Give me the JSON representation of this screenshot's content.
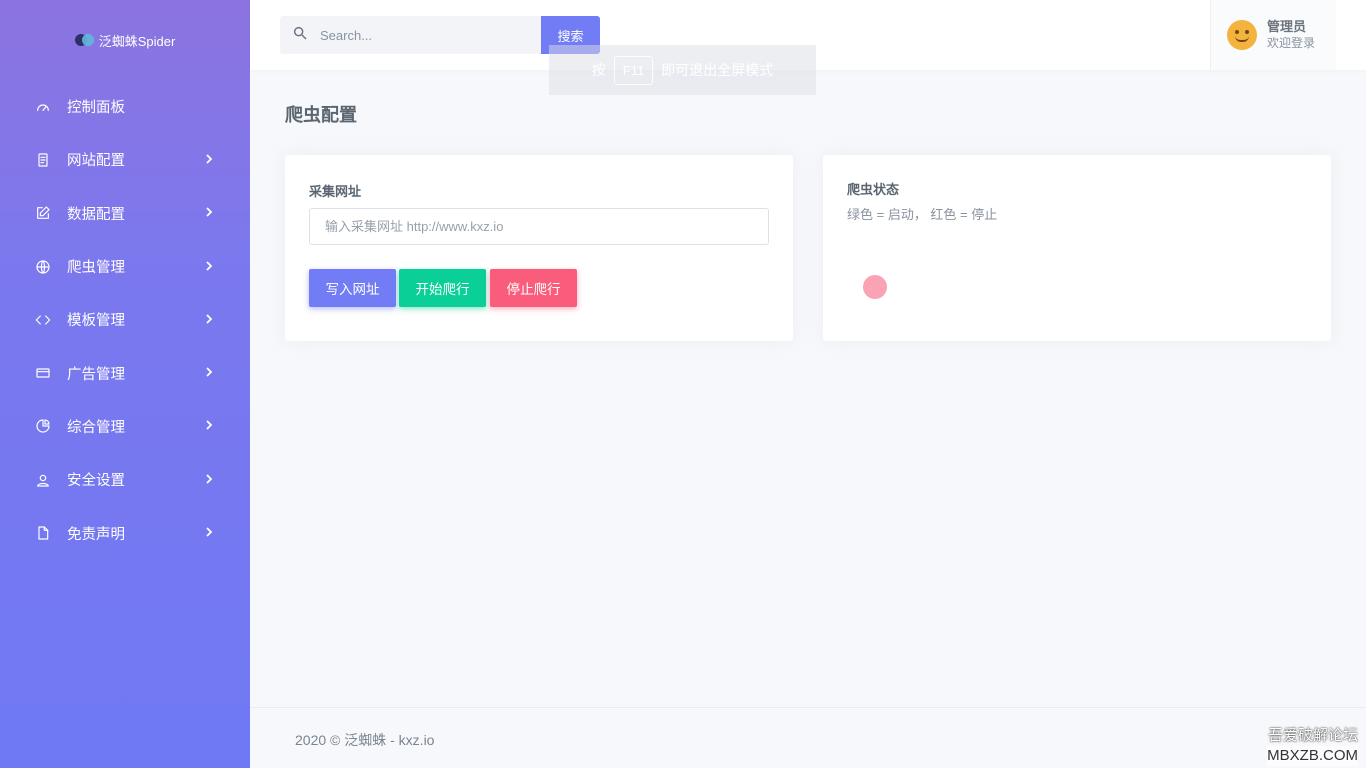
{
  "brand": {
    "name": "泛蜘蛛Spider"
  },
  "sidebar": {
    "items": [
      {
        "label": "控制面板",
        "icon": "gauge-icon",
        "has_arrow": false
      },
      {
        "label": "网站配置",
        "icon": "document-icon",
        "has_arrow": true
      },
      {
        "label": "数据配置",
        "icon": "edit-icon",
        "has_arrow": true
      },
      {
        "label": "爬虫管理",
        "icon": "globe-icon",
        "has_arrow": true
      },
      {
        "label": "模板管理",
        "icon": "code-icon",
        "has_arrow": true
      },
      {
        "label": "广告管理",
        "icon": "card-icon",
        "has_arrow": true
      },
      {
        "label": "综合管理",
        "icon": "pie-chart-icon",
        "has_arrow": true
      },
      {
        "label": "安全设置",
        "icon": "user-icon",
        "has_arrow": true
      },
      {
        "label": "免责声明",
        "icon": "file-icon",
        "has_arrow": true
      }
    ]
  },
  "topbar": {
    "search_placeholder": "Search...",
    "search_button": "搜索",
    "user": {
      "name": "管理员",
      "subtitle": "欢迎登录"
    }
  },
  "toast": {
    "prefix": "按",
    "key": "F11",
    "suffix": "即可退出全屏模式"
  },
  "page": {
    "title": "爬虫配置"
  },
  "left_card": {
    "label": "采集网址",
    "input_placeholder": "输入采集网址 http://www.kxz.io",
    "input_value": "",
    "buttons": {
      "write": "写入网址",
      "start": "开始爬行",
      "stop": "停止爬行"
    }
  },
  "right_card": {
    "title": "爬虫状态",
    "description": "绿色 = 启动， 红色 = 停止",
    "status_color": "#f9a3b4"
  },
  "footer": {
    "text": "2020 © 泛蜘蛛 - kxz.io"
  },
  "watermark": {
    "line1": "吾爱破解论坛",
    "line2": "MBXZB.COM"
  },
  "colors": {
    "primary": "#727cf5",
    "success": "#0acf97",
    "danger": "#fa5c7c"
  }
}
